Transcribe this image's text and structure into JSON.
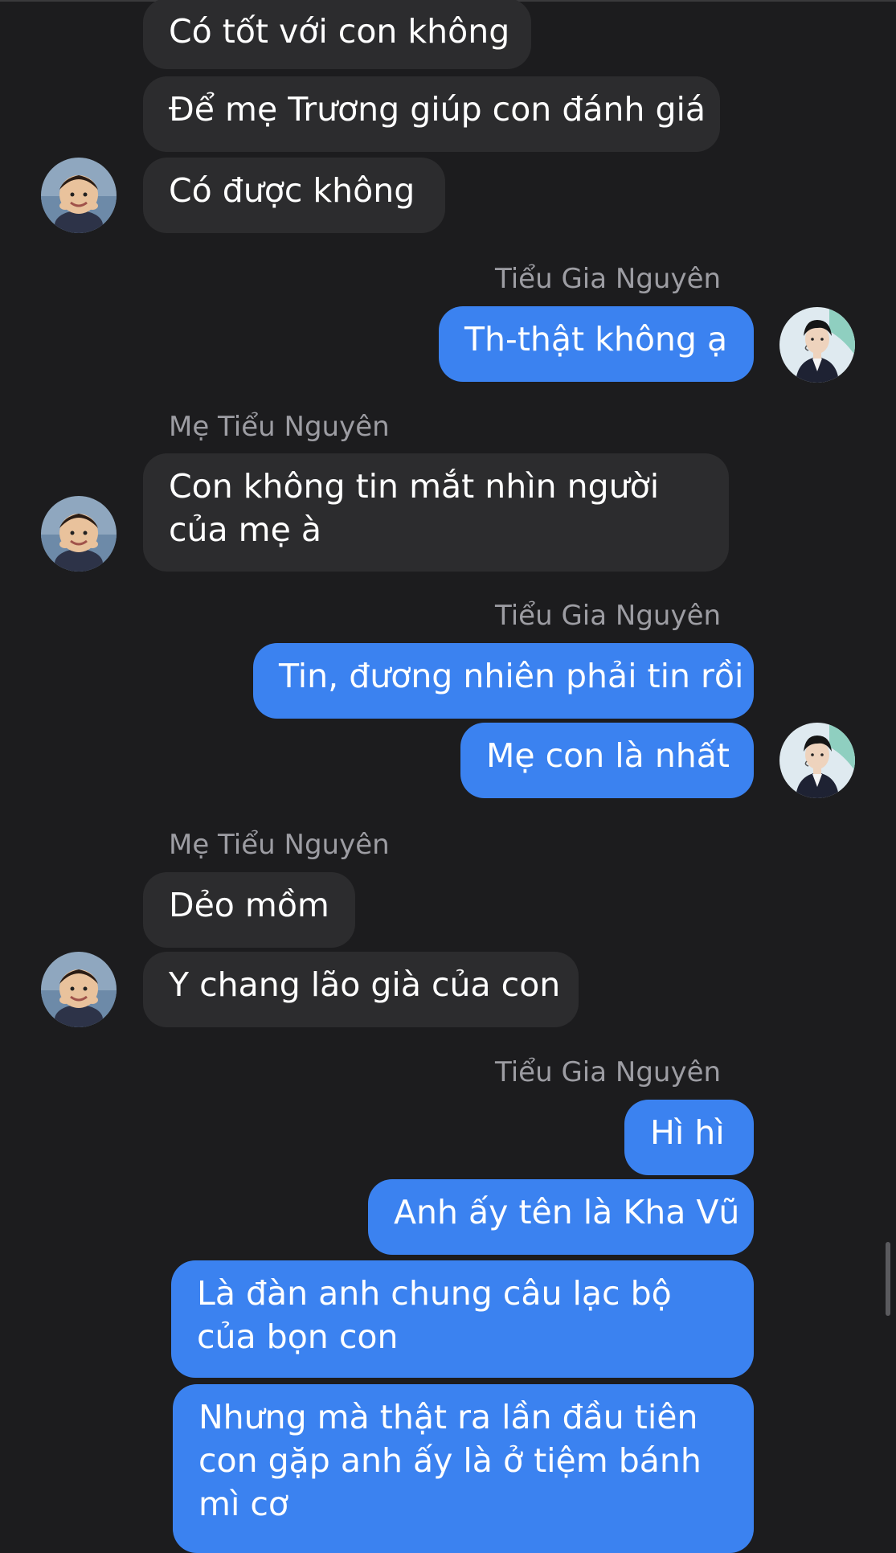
{
  "contacts": {
    "mother": {
      "name": "Mẹ Tiểu Nguyên",
      "avatar_icon": "child-avatar-icon"
    },
    "me": {
      "name": "Tiểu Gia Nguyên",
      "avatar_icon": "young-man-avatar-icon"
    }
  },
  "colors": {
    "background": "#1c1c1e",
    "received_bubble": "#2c2c2e",
    "sent_bubble": "#3b82f0",
    "sender_label": "#9d9da3"
  },
  "messages": [
    {
      "from": "mother",
      "text": "Có tốt với con không"
    },
    {
      "from": "mother",
      "text": "Để mẹ Trương giúp con đánh giá"
    },
    {
      "from": "mother",
      "text": "Có được không"
    },
    {
      "from": "me",
      "sender_label": "Tiểu Gia Nguyên",
      "text": "Th-thật không ạ"
    },
    {
      "from": "mother",
      "sender_label": "Mẹ Tiểu Nguyên",
      "text": "Con không tin mắt nhìn người của mẹ à"
    },
    {
      "from": "me",
      "sender_label": "Tiểu Gia Nguyên",
      "text": "Tin, đương nhiên phải tin rồi"
    },
    {
      "from": "me",
      "text": "Mẹ con là nhất"
    },
    {
      "from": "mother",
      "sender_label": "Mẹ Tiểu Nguyên",
      "text": "Dẻo mồm"
    },
    {
      "from": "mother",
      "text": "Y chang lão già của con"
    },
    {
      "from": "me",
      "sender_label": "Tiểu Gia Nguyên",
      "text": "Hì hì"
    },
    {
      "from": "me",
      "text": "Anh ấy tên là Kha Vũ"
    },
    {
      "from": "me",
      "text": "Là đàn anh chung câu lạc bộ của bọn con"
    },
    {
      "from": "me",
      "text": "Nhưng mà thật ra lần đầu tiên con gặp anh ấy là ở tiệm bánh mì cơ"
    }
  ]
}
